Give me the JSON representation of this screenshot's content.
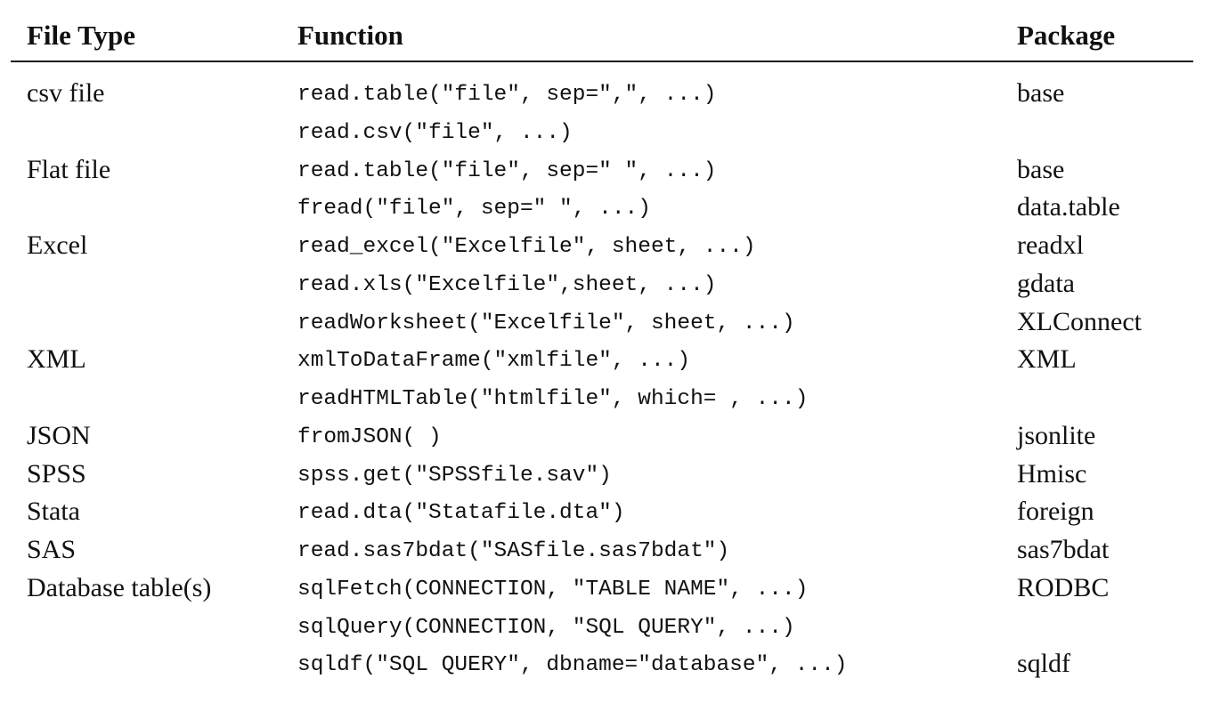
{
  "table": {
    "headers": {
      "file_type": "File Type",
      "function": "Function",
      "package": "Package"
    },
    "rows": [
      {
        "file_type": "csv file",
        "function": "read.table(\"file\", sep=\",\", ...)",
        "package": "base"
      },
      {
        "file_type": "",
        "function": "read.csv(\"file\", ...)",
        "package": ""
      },
      {
        "file_type": "Flat file",
        "function": "read.table(\"file\", sep=\" \", ...)",
        "package": "base"
      },
      {
        "file_type": "",
        "function": "fread(\"file\", sep=\" \", ...)",
        "package": "data.table"
      },
      {
        "file_type": "Excel",
        "function": "read_excel(\"Excelfile\", sheet, ...)",
        "package": "readxl"
      },
      {
        "file_type": "",
        "function": "read.xls(\"Excelfile\",sheet, ...)",
        "package": "gdata"
      },
      {
        "file_type": "",
        "function": "readWorksheet(\"Excelfile\", sheet, ...)",
        "package": "XLConnect"
      },
      {
        "file_type": "XML",
        "function": "xmlToDataFrame(\"xmlfile\", ...)",
        "package": "XML"
      },
      {
        "file_type": "",
        "function": "readHTMLTable(\"htmlfile\", which= , ...)",
        "package": ""
      },
      {
        "file_type": "JSON",
        "function": "fromJSON( )",
        "package": "jsonlite"
      },
      {
        "file_type": "SPSS",
        "function": "spss.get(\"SPSSfile.sav\")",
        "package": "Hmisc"
      },
      {
        "file_type": "Stata",
        "function": "read.dta(\"Statafile.dta\")",
        "package": "foreign"
      },
      {
        "file_type": "SAS",
        "function": "read.sas7bdat(\"SASfile.sas7bdat\")",
        "package": "sas7bdat"
      },
      {
        "file_type": "Database table(s)",
        "function": "sqlFetch(CONNECTION, \"TABLE NAME\", ...)",
        "package": "RODBC"
      },
      {
        "file_type": "",
        "function": "sqlQuery(CONNECTION, \"SQL QUERY\", ...)",
        "package": ""
      },
      {
        "file_type": "",
        "function": "sqldf(\"SQL QUERY\", dbname=\"database\", ...)",
        "package": "sqldf"
      }
    ]
  }
}
